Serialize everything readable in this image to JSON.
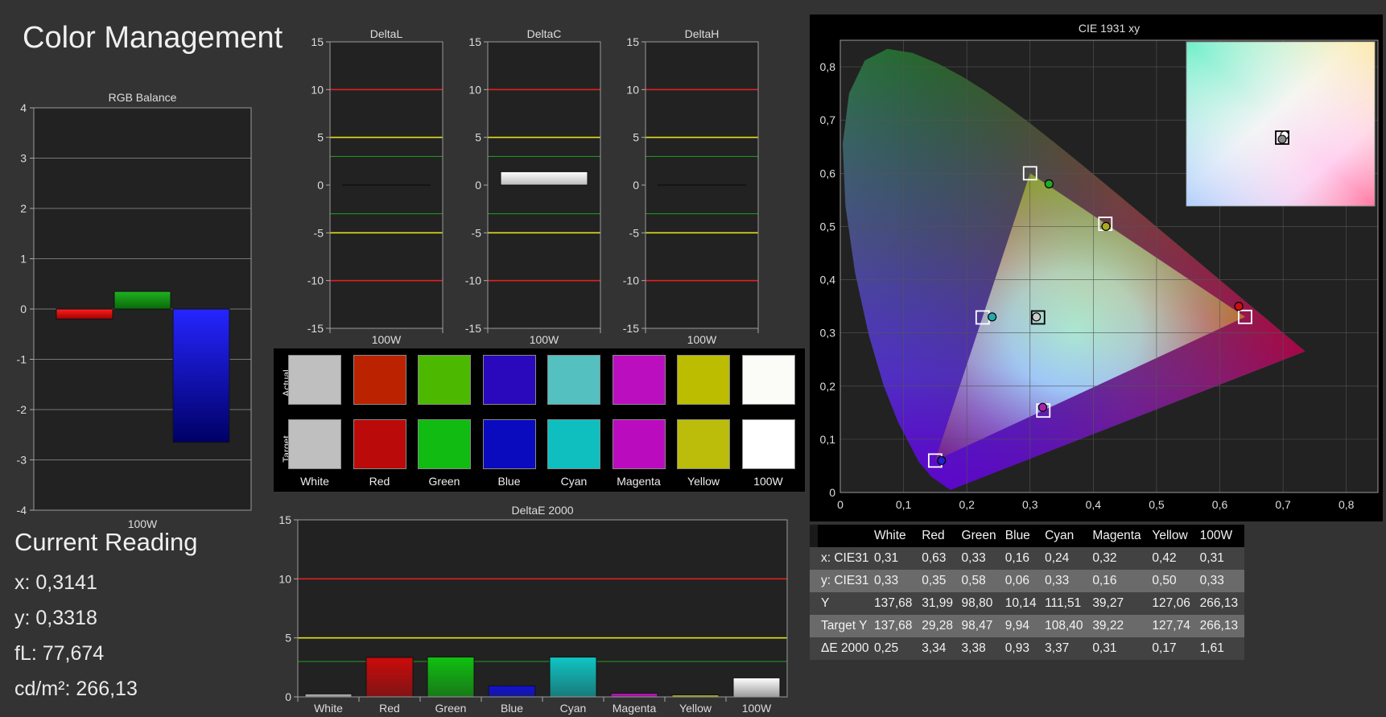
{
  "page_title": "Color Management",
  "current_reading": {
    "heading": "Current Reading",
    "x": "x: 0,3141",
    "y": "y: 0,3318",
    "fl": "fL: 77,674",
    "cdm2": "cd/m²: 266,13"
  },
  "swatches": {
    "row_labels": [
      "Actual",
      "Target"
    ],
    "items": [
      {
        "label": "White",
        "actual": "#bfbfbf",
        "target": "#bfbfbf"
      },
      {
        "label": "Red",
        "actual": "#bb2200",
        "target": "#bb0a0a"
      },
      {
        "label": "Green",
        "actual": "#4db800",
        "target": "#11bb11"
      },
      {
        "label": "Blue",
        "actual": "#2a08bb",
        "target": "#0a0abf"
      },
      {
        "label": "Cyan",
        "actual": "#55c0c0",
        "target": "#0fbfbf"
      },
      {
        "label": "Magenta",
        "actual": "#bb0fbf",
        "target": "#bb0bbf"
      },
      {
        "label": "Yellow",
        "actual": "#bcbc00",
        "target": "#bcbc0a"
      },
      {
        "label": "100W",
        "actual": "#fbfbf8",
        "target": "#ffffff"
      }
    ]
  },
  "chart_data": [
    {
      "type": "bar",
      "title": "RGB Balance",
      "categories": [
        "100W"
      ],
      "series": [
        {
          "name": "Red",
          "values": [
            -0.2
          ]
        },
        {
          "name": "Green",
          "values": [
            0.35
          ]
        },
        {
          "name": "Blue",
          "values": [
            -2.65
          ]
        }
      ],
      "ylim": [
        -4,
        4
      ],
      "ticks": [
        "4",
        "3",
        "2",
        "1",
        "0",
        "-1",
        "-2",
        "-3",
        "-4"
      ],
      "colors": [
        "#ff1010",
        "#1a9a1a",
        "#1a1aff"
      ]
    },
    {
      "type": "bar",
      "title": "DeltaL",
      "categories": [
        "100W"
      ],
      "values": [
        0
      ],
      "ylim": [
        -15,
        15
      ],
      "ticks": [
        "15",
        "10",
        "5",
        "0",
        "-5",
        "-10",
        "-15"
      ],
      "thresholds": {
        "red": 10,
        "yellow": 5,
        "green": 3
      }
    },
    {
      "type": "bar",
      "title": "DeltaC",
      "categories": [
        "100W"
      ],
      "values": [
        1.4
      ],
      "ylim": [
        -15,
        15
      ],
      "ticks": [
        "15",
        "10",
        "5",
        "0",
        "-5",
        "-10",
        "-15"
      ],
      "thresholds": {
        "red": 10,
        "yellow": 5,
        "green": 3
      }
    },
    {
      "type": "bar",
      "title": "DeltaH",
      "categories": [
        "100W"
      ],
      "values": [
        0
      ],
      "ylim": [
        -15,
        15
      ],
      "ticks": [
        "15",
        "10",
        "5",
        "0",
        "-5",
        "-10",
        "-15"
      ],
      "thresholds": {
        "red": 10,
        "yellow": 5,
        "green": 3
      }
    },
    {
      "type": "bar",
      "title": "DeltaE 2000",
      "categories": [
        "White",
        "Red",
        "Green",
        "Blue",
        "Cyan",
        "Magenta",
        "Yellow",
        "100W"
      ],
      "values": [
        0.25,
        3.34,
        3.38,
        0.93,
        3.37,
        0.31,
        0.17,
        1.61
      ],
      "colors": [
        "#c8c8c8",
        "#cc0a0a",
        "#10c010",
        "#1010dd",
        "#10c4c4",
        "#cc10cc",
        "#c8c810",
        "#ffffff"
      ],
      "ylim": [
        0,
        15
      ],
      "ticks": [
        "15",
        "10",
        "5",
        "0"
      ],
      "thresholds": {
        "red": 10,
        "yellow": 5,
        "green": 3
      }
    },
    {
      "type": "scatter",
      "title": "CIE 1931 xy",
      "xlim": [
        0,
        0.85
      ],
      "ylim": [
        0,
        0.85
      ],
      "xticks": [
        "0",
        "0,1",
        "0,2",
        "0,3",
        "0,4",
        "0,5",
        "0,6",
        "0,7",
        "0,8"
      ],
      "yticks": [
        "0",
        "0,1",
        "0,2",
        "0,3",
        "0,4",
        "0,5",
        "0,6",
        "0,7",
        "0,8"
      ],
      "targets": [
        {
          "name": "Red",
          "x": 0.64,
          "y": 0.33
        },
        {
          "name": "Green",
          "x": 0.3,
          "y": 0.6
        },
        {
          "name": "Blue",
          "x": 0.15,
          "y": 0.06
        },
        {
          "name": "Cyan",
          "x": 0.225,
          "y": 0.329
        },
        {
          "name": "Magenta",
          "x": 0.321,
          "y": 0.154
        },
        {
          "name": "Yellow",
          "x": 0.419,
          "y": 0.505
        },
        {
          "name": "White",
          "x": 0.3127,
          "y": 0.329
        }
      ],
      "measured": [
        {
          "name": "Red",
          "x": 0.63,
          "y": 0.35,
          "color": "#cc1111"
        },
        {
          "name": "Green",
          "x": 0.33,
          "y": 0.58,
          "color": "#22aa22"
        },
        {
          "name": "Blue",
          "x": 0.16,
          "y": 0.06,
          "color": "#2222cc"
        },
        {
          "name": "Cyan",
          "x": 0.24,
          "y": 0.33,
          "color": "#22aaaa"
        },
        {
          "name": "Magenta",
          "x": 0.32,
          "y": 0.16,
          "color": "#aa22aa"
        },
        {
          "name": "Yellow",
          "x": 0.42,
          "y": 0.5,
          "color": "#aaaa22"
        },
        {
          "name": "White",
          "x": 0.31,
          "y": 0.33,
          "color": "#cccccc"
        }
      ]
    }
  ],
  "table": {
    "headers": [
      "",
      "White",
      "Red",
      "Green",
      "Blue",
      "Cyan",
      "Magenta",
      "Yellow",
      "100W"
    ],
    "rows": [
      [
        "x: CIE31",
        "0,31",
        "0,63",
        "0,33",
        "0,16",
        "0,24",
        "0,32",
        "0,42",
        "0,31"
      ],
      [
        "y: CIE31",
        "0,33",
        "0,35",
        "0,58",
        "0,06",
        "0,33",
        "0,16",
        "0,50",
        "0,33"
      ],
      [
        "Y",
        "137,68",
        "31,99",
        "98,80",
        "10,14",
        "111,51",
        "39,27",
        "127,06",
        "266,13"
      ],
      [
        "Target Y",
        "137,68",
        "29,28",
        "98,47",
        "9,94",
        "108,40",
        "39,22",
        "127,74",
        "266,13"
      ],
      [
        "ΔE 2000",
        "0,25",
        "3,34",
        "3,38",
        "0,93",
        "3,37",
        "0,31",
        "0,17",
        "1,61"
      ]
    ]
  }
}
